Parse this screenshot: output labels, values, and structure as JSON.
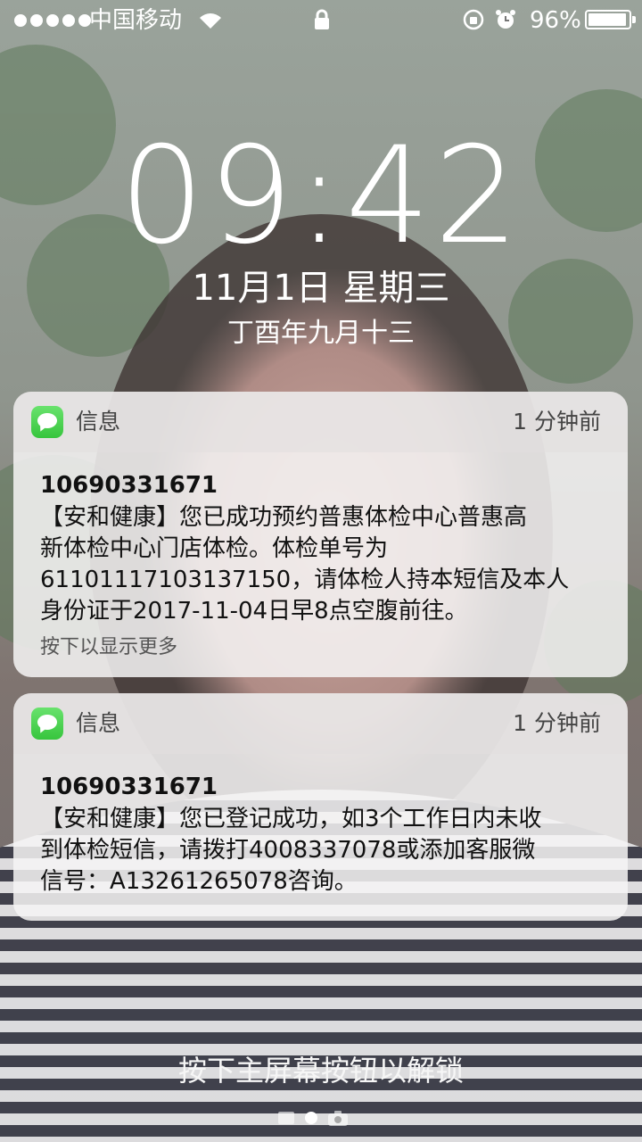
{
  "status_bar": {
    "carrier": "中国移动",
    "battery_percent": "96%",
    "battery_level": 0.96
  },
  "lock_screen": {
    "time": "09:42",
    "date": "11月1日 星期三",
    "lunar_date": "丁酉年九月十三"
  },
  "notifications": [
    {
      "app": "信息",
      "time_ago": "1 分钟前",
      "sender": "10690331671",
      "message": "【安和健康】您已成功预约普惠体检中心普惠高\n新体检中心门店体检。体检单号为\n61101117103137150，请体检人持本短信及本人\n身份证于2017-11-04日早8点空腹前往。",
      "more_hint": "按下以显示更多"
    },
    {
      "app": "信息",
      "time_ago": "1 分钟前",
      "sender": "10690331671",
      "message": "【安和健康】您已登记成功，如3个工作日内未收\n到体检短信，请拨打4008337078或添加客服微\n信号：A13261265078咨询。"
    }
  ],
  "unlock_hint": "按下主屏幕按钮以解锁",
  "colors": {
    "messages_green": "#4cd964",
    "card_background": "#f6f4f4"
  }
}
